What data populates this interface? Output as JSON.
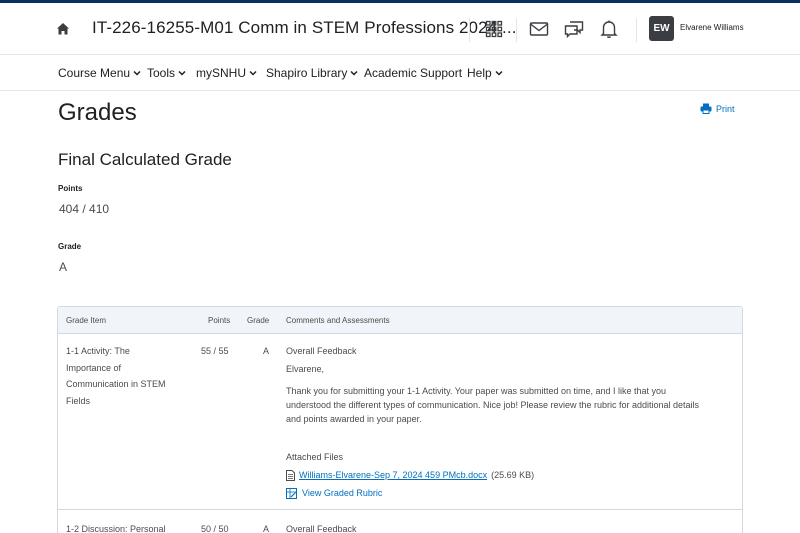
{
  "header": {
    "course_title": "IT-226-16255-M01 Comm in STEM Professions 2024 ...",
    "avatar_initials": "EW",
    "user_name": "Elvarene Williams",
    "icons": [
      "home-icon",
      "grid-icon",
      "mail-icon",
      "chat-icon",
      "bell-icon"
    ]
  },
  "nav": {
    "items": [
      {
        "label": "Course Menu"
      },
      {
        "label": "Tools"
      },
      {
        "label": "mySNHU"
      },
      {
        "label": "Shapiro Library"
      },
      {
        "label": "Academic Support"
      },
      {
        "label": "Help"
      }
    ]
  },
  "page": {
    "title": "Grades",
    "print_label": "Print",
    "final_grade_title": "Final Calculated Grade",
    "points_label": "Points",
    "points_value": "404 / 410",
    "grade_label": "Grade",
    "grade_value": "A"
  },
  "table": {
    "headers": {
      "item": "Grade Item",
      "points": "Points",
      "grade": "Grade",
      "comments": "Comments and Assessments"
    },
    "rows": [
      {
        "name_lines": [
          "1-1 Activity: The",
          "Importance of",
          "Communication in STEM",
          "Fields"
        ],
        "points": "55 / 55",
        "grade": "A",
        "feedback_title": "Overall Feedback",
        "greeting": "Elvarene,",
        "feedback_lines": [
          "Thank you for submitting your 1-1 Activity. Your paper was submitted on time, and I like that you",
          "understood the different types of communication. Nice job! Please review the rubric for additional details",
          "and points awarded in your paper."
        ],
        "attached_label": "Attached Files",
        "file_name": "Williams-Elvarene-Sep 7, 2024 459 PMcb.docx",
        "file_size": "(25.69 KB)",
        "rubric_label": "View Graded Rubric"
      },
      {
        "name_lines": [
          "1-2 Discussion: Personal"
        ],
        "points": "50 / 50",
        "grade": "A",
        "feedback_title": "Overall Feedback"
      }
    ]
  },
  "colors": {
    "top_stripe": "#0b2f63",
    "link": "#006fbf",
    "avatar_bg": "#3a3e42",
    "table_header_bg": "#f1f5fb"
  }
}
